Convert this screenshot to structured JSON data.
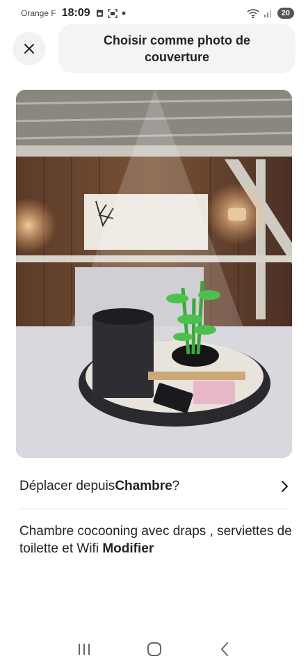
{
  "status_bar": {
    "carrier": "Orange F",
    "time": "18:09",
    "battery": "20",
    "icons": [
      "sim-icon",
      "screenshot-icon",
      "dot-icon",
      "wifi-icon",
      "signal-icon",
      "battery-icon"
    ]
  },
  "header": {
    "close_icon": "close-icon",
    "title": "Choisir comme photo de couverture"
  },
  "photo": {
    "description_icon": "cover-photo"
  },
  "move_row": {
    "prefix": "Déplacer depuis ",
    "room": "Chambre",
    "suffix": " ?",
    "icon": "chevron-right-icon"
  },
  "caption": {
    "text": "Chambre cocooning avec draps , serviettes de toilette et Wifi ",
    "modify_label": "Modifier"
  },
  "nav_bar": {
    "icons": [
      "recent-apps-icon",
      "home-icon",
      "back-icon"
    ]
  },
  "colors": {
    "text": "#222222",
    "pill_bg": "#f4f4f4",
    "close_bg": "#f2f2f2",
    "divider": "#dddddd"
  }
}
